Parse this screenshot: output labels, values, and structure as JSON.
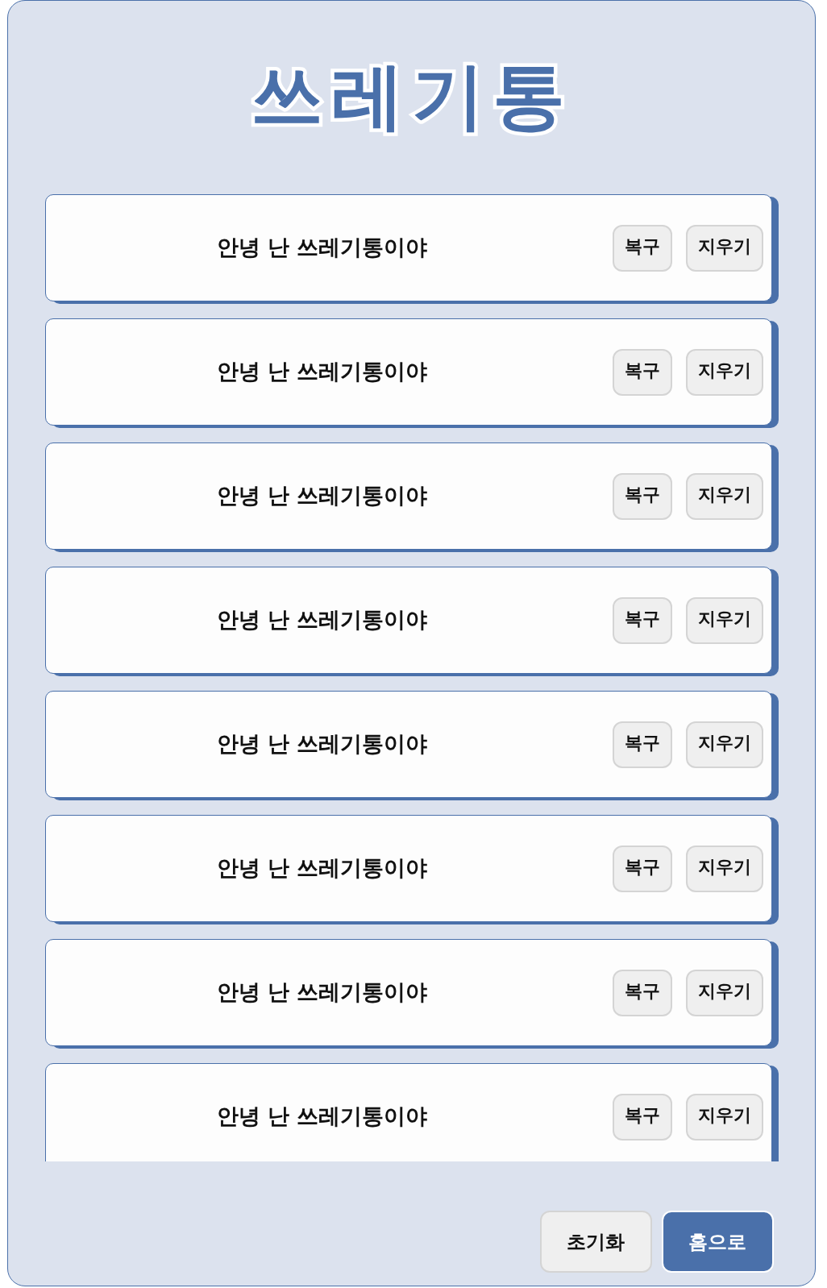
{
  "title": "쓰레기통",
  "items": [
    {
      "text": "안녕 난 쓰레기통이야",
      "restore": "복구",
      "delete": "지우기"
    },
    {
      "text": "안녕 난 쓰레기통이야",
      "restore": "복구",
      "delete": "지우기"
    },
    {
      "text": "안녕 난 쓰레기통이야",
      "restore": "복구",
      "delete": "지우기"
    },
    {
      "text": "안녕 난 쓰레기통이야",
      "restore": "복구",
      "delete": "지우기"
    },
    {
      "text": "안녕 난 쓰레기통이야",
      "restore": "복구",
      "delete": "지우기"
    },
    {
      "text": "안녕 난 쓰레기통이야",
      "restore": "복구",
      "delete": "지우기"
    },
    {
      "text": "안녕 난 쓰레기통이야",
      "restore": "복구",
      "delete": "지우기"
    },
    {
      "text": "안녕 난 쓰레기통이야",
      "restore": "복구",
      "delete": "지우기"
    }
  ],
  "footer": {
    "reset": "초기화",
    "home": "홈으로"
  }
}
